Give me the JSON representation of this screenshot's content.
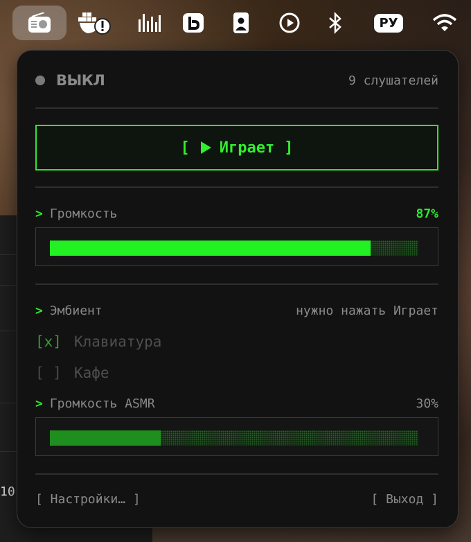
{
  "background": {
    "window_text": "10"
  },
  "menubar": {
    "icons": [
      "radio-icon",
      "docker-alert-icon",
      "audio-bars-icon",
      "b-app-icon",
      "badge-icon",
      "play-circle-icon",
      "bluetooth-icon",
      "language-icon",
      "wifi-icon"
    ],
    "language": "РУ"
  },
  "panel": {
    "status_label": "ВЫКЛ",
    "listeners": "9 слушателей",
    "play_button": {
      "open_bracket": "[",
      "label": "Играет",
      "close_bracket": "]"
    },
    "prompt_symbol": ">",
    "volume": {
      "label": "Громкость",
      "value_text": "87%",
      "level": 0.87
    },
    "ambient": {
      "label": "Эмбиент",
      "hint": "нужно нажать Играет",
      "options": [
        {
          "mark": "[x]",
          "label": "Клавиатура",
          "checked": true
        },
        {
          "mark": "[ ]",
          "label": "Кафе",
          "checked": false
        }
      ]
    },
    "asmr_volume": {
      "label": "Громкость ASMR",
      "value_text": "30%",
      "level": 0.3
    },
    "footer": {
      "settings": "[ Настройки… ]",
      "quit": "[ Выход ]"
    }
  },
  "colors": {
    "accent_green": "#2ee62e",
    "fill_bright": "#22f022",
    "fill_dim": "#1e8f1e",
    "panel_bg": "#121212",
    "muted_text": "#8a8a8a"
  }
}
